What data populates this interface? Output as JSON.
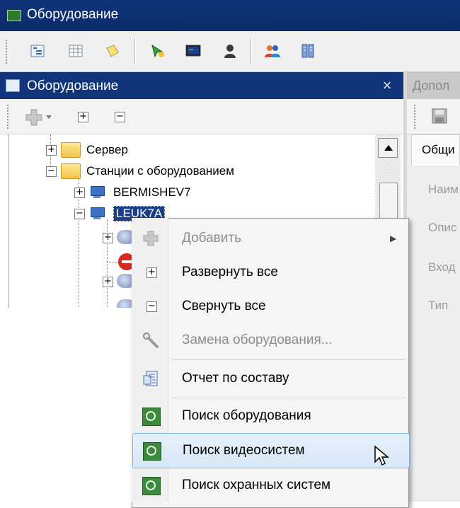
{
  "window": {
    "title": "Оборудование"
  },
  "main_toolbar": {
    "buttons": [
      "tree-view-icon",
      "grid-icon",
      "notes-icon",
      "add-device-icon",
      "monitor-icon",
      "user-icon",
      "users-icon",
      "equipment-icon"
    ]
  },
  "panel": {
    "title": "Оборудование",
    "close_glyph": "×"
  },
  "right_panel": {
    "title": "Допол",
    "tab": "Общи",
    "fields": [
      "Наим",
      "Опис",
      "Вход",
      "Тип"
    ]
  },
  "tree_toolbar": {
    "expand_glyph": "+",
    "collapse_glyph": "−"
  },
  "tree": {
    "nodes": [
      {
        "label": "Сервер",
        "toggle": "+"
      },
      {
        "label": "Станции с оборудованием",
        "toggle": "−"
      },
      {
        "label": "BERMISHEV7",
        "toggle": "+"
      },
      {
        "label": "LEUK7A",
        "toggle": "−"
      }
    ]
  },
  "context_menu": {
    "items": [
      {
        "label": "Добавить",
        "disabled": true,
        "submenu": true
      },
      {
        "label": "Развернуть все",
        "disabled": false
      },
      {
        "label": "Свернуть все",
        "disabled": false
      },
      {
        "label": "Замена оборудования...",
        "disabled": true
      },
      {
        "label": "Отчет по составу",
        "disabled": false
      },
      {
        "label": "Поиск оборудования",
        "disabled": false
      },
      {
        "label": "Поиск видеосистем",
        "disabled": false,
        "highlighted": true
      },
      {
        "label": "Поиск охранных систем",
        "disabled": false
      }
    ],
    "submenu_arrow": "▶",
    "glyph_plus": "+",
    "glyph_minus": "−"
  },
  "colors": {
    "title_bar": "#10357a",
    "selection": "#1c3f8a",
    "hover": "#d7e8f8"
  }
}
